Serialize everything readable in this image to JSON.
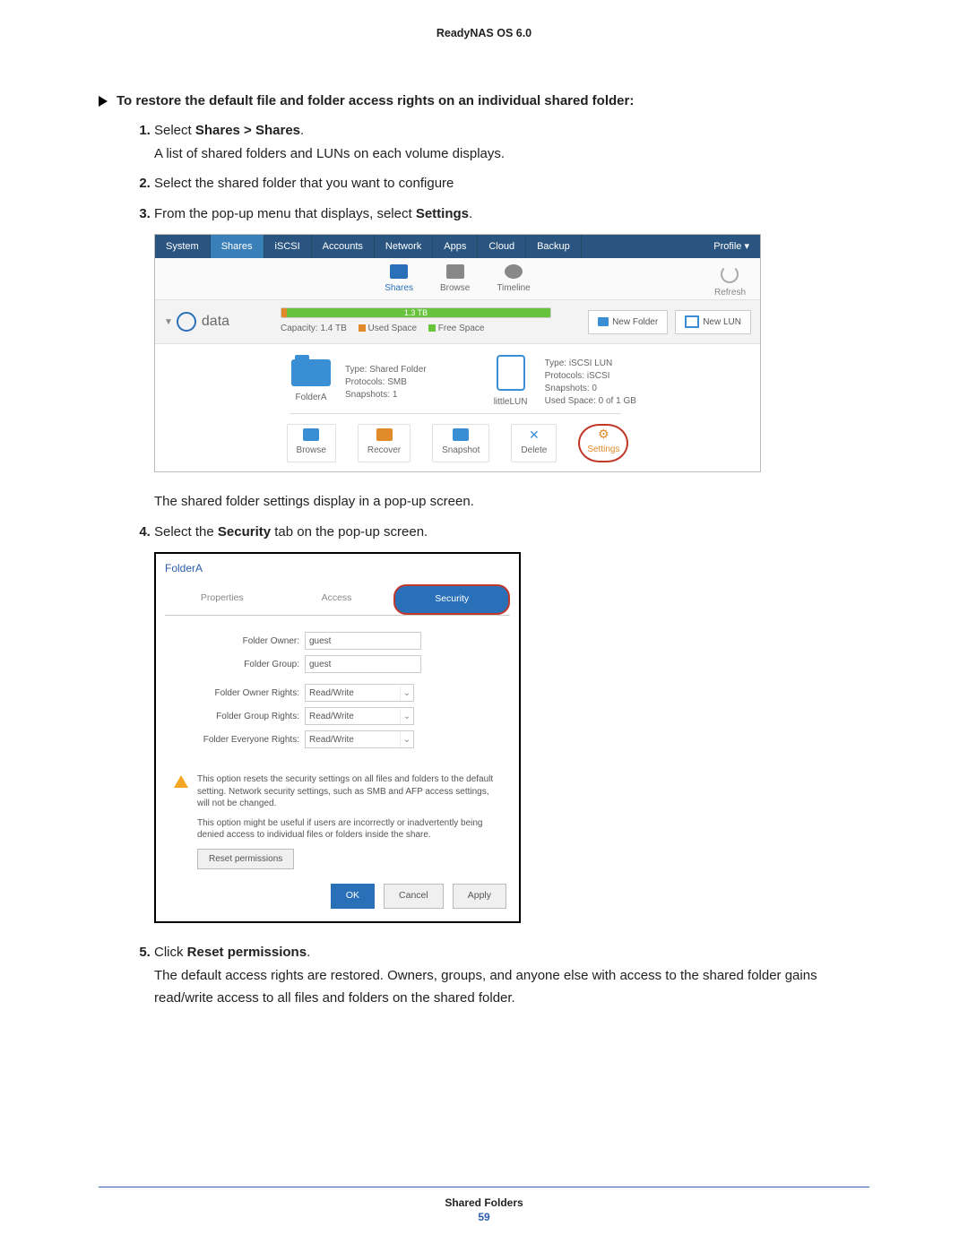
{
  "header": "ReadyNAS OS 6.0",
  "section_title": "To restore the default file and folder access rights on an individual shared folder:",
  "steps": {
    "s1_pre": "Select ",
    "s1_bold": "Shares > Shares",
    "s1_post": ".",
    "s1_desc": "A list of shared folders and LUNs on each volume displays.",
    "s2": "Select the shared folder that you want to configure",
    "s3_pre": "From the pop-up menu that displays, select ",
    "s3_bold": "Settings",
    "s3_post": ".",
    "s3_follow": "The shared folder settings display in a pop-up screen.",
    "s4_pre": "Select the ",
    "s4_bold": "Security",
    "s4_post": " tab on the pop-up screen.",
    "s5_pre": "Click ",
    "s5_bold": "Reset permissions",
    "s5_post": ".",
    "s5_desc": "The default access rights are restored. Owners, groups, and anyone else with access to the shared folder gains read/write access to all files and folders on the shared folder."
  },
  "shot1": {
    "nav": [
      "System",
      "Shares",
      "iSCSI",
      "Accounts",
      "Network",
      "Apps",
      "Cloud",
      "Backup"
    ],
    "nav_active": "Shares",
    "profile": "Profile ▾",
    "subnav": {
      "shares": "Shares",
      "browse": "Browse",
      "timeline": "Timeline",
      "refresh": "Refresh"
    },
    "volume": {
      "name": "data",
      "bar": "1.3 TB",
      "capacity": "Capacity: 1.4 TB",
      "used": "Used Space",
      "free": "Free Space",
      "btn_new_folder": "New Folder",
      "btn_new_lun": "New LUN"
    },
    "folder": {
      "name": "FolderA",
      "l1": "Type: Shared Folder",
      "l2": "Protocols: SMB",
      "l3": "Snapshots: 1"
    },
    "lun": {
      "name": "littleLUN",
      "l1": "Type: iSCSI LUN",
      "l2": "Protocols: iSCSI",
      "l3": "Snapshots: 0",
      "l4": "Used Space: 0 of 1 GB"
    },
    "toolbar": {
      "browse": "Browse",
      "recover": "Recover",
      "snapshot": "Snapshot",
      "delete": "Delete",
      "settings": "Settings"
    }
  },
  "shot2": {
    "title": "FolderA",
    "tabs": {
      "properties": "Properties",
      "access": "Access",
      "security": "Security"
    },
    "fields": {
      "owner_l": "Folder Owner:",
      "owner_v": "guest",
      "group_l": "Folder Group:",
      "group_v": "guest",
      "owner_r_l": "Folder Owner Rights:",
      "owner_r_v": "Read/Write",
      "group_r_l": "Folder Group Rights:",
      "group_r_v": "Read/Write",
      "every_r_l": "Folder Everyone Rights:",
      "every_r_v": "Read/Write"
    },
    "warn1": "This option resets the security settings on all files and folders to the default setting. Network security settings, such as SMB and AFP access settings, will not be changed.",
    "warn2": "This option might be useful if users are incorrectly or inadvertently being denied access to individual files or folders inside the share.",
    "reset": "Reset permissions",
    "ok": "OK",
    "cancel": "Cancel",
    "apply": "Apply"
  },
  "footer": {
    "title": "Shared Folders",
    "page": "59"
  }
}
